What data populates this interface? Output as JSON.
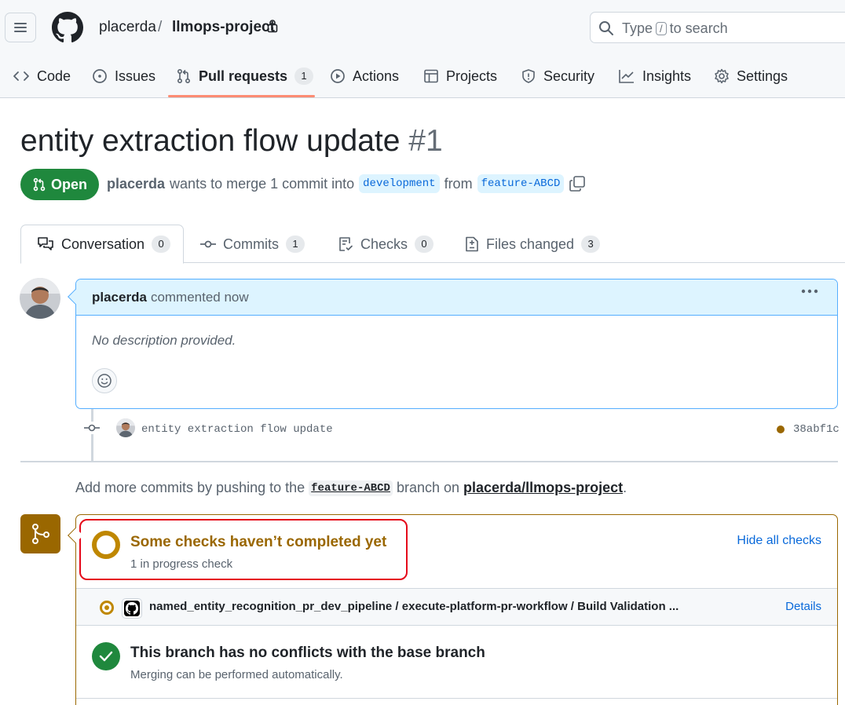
{
  "header": {
    "owner": "placerda",
    "separator": "/",
    "repo": "llmops-project",
    "search": {
      "prefix": "Type",
      "key": "/",
      "suffix": "to search"
    }
  },
  "nav": {
    "items": [
      {
        "label": "Code",
        "icon": "code-icon"
      },
      {
        "label": "Issues",
        "icon": "issue-opened-icon"
      },
      {
        "label": "Pull requests",
        "icon": "git-pull-request-icon",
        "count": "1",
        "active": true
      },
      {
        "label": "Actions",
        "icon": "play-icon"
      },
      {
        "label": "Projects",
        "icon": "table-icon"
      },
      {
        "label": "Security",
        "icon": "shield-icon"
      },
      {
        "label": "Insights",
        "icon": "graph-icon"
      },
      {
        "label": "Settings",
        "icon": "gear-icon"
      }
    ],
    "active_color": "#fd8c73"
  },
  "pr": {
    "title": "entity extraction flow update",
    "number": "#1",
    "state": "Open",
    "state_color": "#1f883d",
    "author": "placerda",
    "merge_text": "wants to merge 1 commit into",
    "base_branch": "development",
    "from_text": "from",
    "head_branch": "feature-ABCD"
  },
  "tabs": [
    {
      "label": "Conversation",
      "count": "0",
      "icon": "comment-discussion-icon",
      "active": true
    },
    {
      "label": "Commits",
      "count": "1",
      "icon": "git-commit-icon"
    },
    {
      "label": "Checks",
      "count": "0",
      "icon": "checklist-icon"
    },
    {
      "label": "Files changed",
      "count": "3",
      "icon": "file-diff-icon"
    }
  ],
  "comment": {
    "author": "placerda",
    "action": "commented now",
    "body": "No description provided."
  },
  "commit": {
    "message": "entity extraction flow update",
    "sha": "38abf1c",
    "status_color": "#9a6700"
  },
  "push_note": {
    "prefix": "Add more commits by pushing to the",
    "branch": "feature-ABCD",
    "middle": "branch on",
    "repo": "placerda/llmops-project",
    "suffix": "."
  },
  "merge_box": {
    "checks_title": "Some checks haven’t completed yet",
    "checks_subtitle": "1 in progress check",
    "hide_checks": "Hide all checks",
    "check_name": "named_entity_recognition_pr_dev_pipeline / execute-platform-pr-workflow / Build Validation ...",
    "details": "Details",
    "noconf_title": "This branch has no conflicts with the base branch",
    "noconf_subtitle": "Merging can be performed automatically.",
    "pending_color": "#bf8700",
    "success_color": "#1f883d"
  }
}
